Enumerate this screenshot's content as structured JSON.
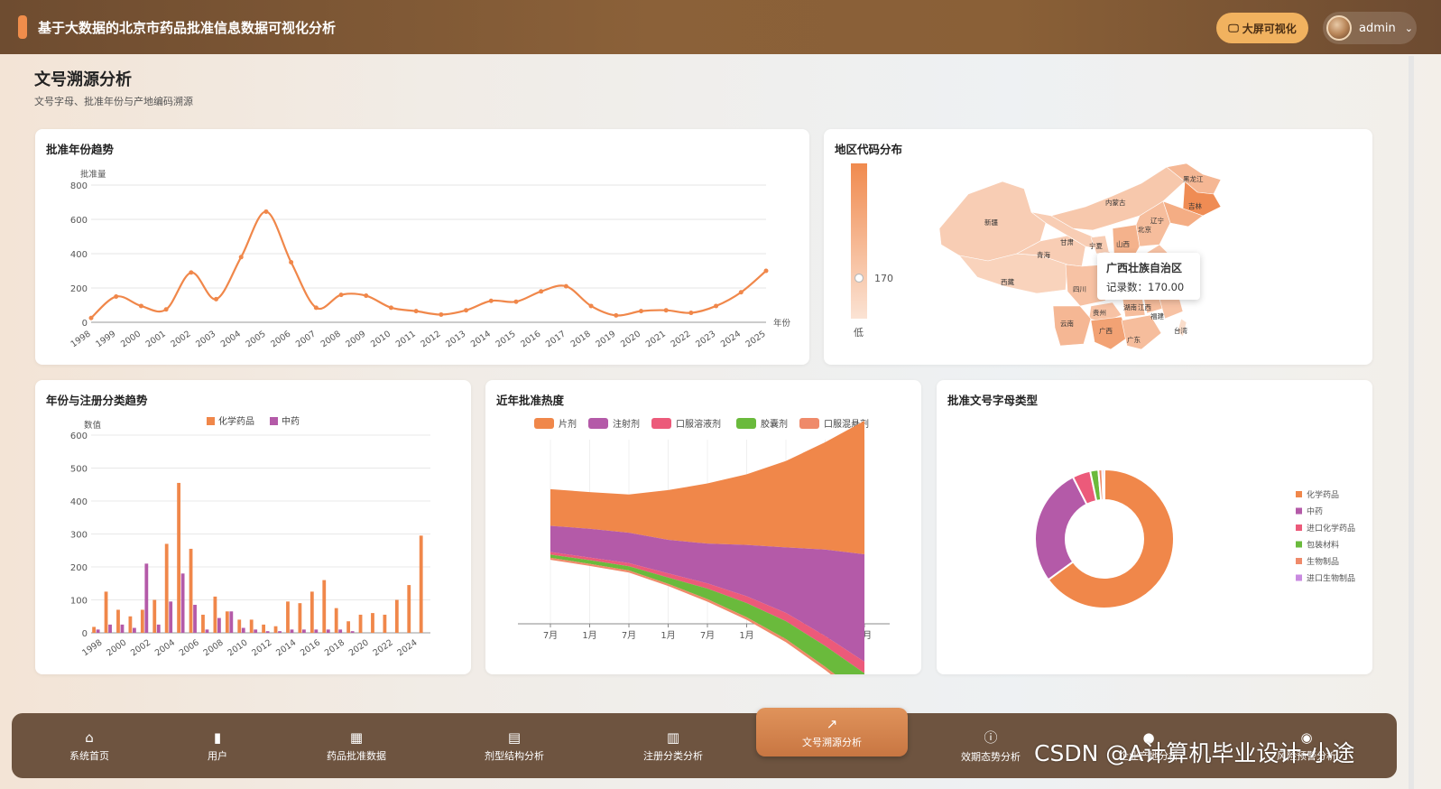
{
  "header": {
    "title": "基于大数据的北京市药品批准信息数据可视化分析",
    "big_screen_label": "大屏可视化",
    "user": "admin"
  },
  "page": {
    "title": "文号溯源分析",
    "subtitle": "文号字母、批准年份与产地编码溯源"
  },
  "cards": {
    "year_trend": "批准年份趋势",
    "region": "地区代码分布",
    "category_trend": "年份与注册分类趋势",
    "heat": "近年批准热度",
    "letter_type": "批准文号字母类型"
  },
  "tooltip": {
    "title": "广西壮族自治区",
    "body": "记录数：170.00"
  },
  "colors": {
    "accent": "#f0874a",
    "purple": "#b45aa8",
    "pink": "#ec5a7a",
    "green": "#6aba3c",
    "salmon": "#ef8a6a",
    "lavender": "#c98ae0"
  },
  "chart_data": [
    {
      "type": "line",
      "title": "批准年份趋势",
      "ylabel": "批准量",
      "xlabel": "年份",
      "ylim": [
        0,
        800
      ],
      "yticks": [
        0,
        200,
        400,
        600,
        800
      ],
      "x": [
        "1998",
        "1999",
        "2000",
        "2001",
        "2002",
        "2003",
        "2004",
        "2005",
        "2006",
        "2007",
        "2008",
        "2009",
        "2010",
        "2011",
        "2012",
        "2013",
        "2014",
        "2015",
        "2016",
        "2017",
        "2018",
        "2019",
        "2020",
        "2021",
        "2022",
        "2023",
        "2024",
        "2025"
      ],
      "values": [
        25,
        150,
        95,
        75,
        290,
        135,
        380,
        645,
        350,
        85,
        160,
        155,
        85,
        65,
        45,
        70,
        125,
        120,
        180,
        210,
        95,
        40,
        65,
        70,
        55,
        95,
        175,
        300
      ],
      "grid": true
    },
    {
      "type": "heatmap",
      "title": "地区代码分布",
      "visual_map": {
        "low_label": "低",
        "current_label": "170",
        "current": 170
      },
      "regions": [
        {
          "name": "新疆",
          "level": 0.2
        },
        {
          "name": "西藏",
          "level": 0.15
        },
        {
          "name": "青海",
          "level": 0.2
        },
        {
          "name": "甘肃",
          "level": 0.2
        },
        {
          "name": "内蒙古",
          "level": 0.25
        },
        {
          "name": "黑龙江",
          "level": 0.4
        },
        {
          "name": "吉林",
          "level": 0.8
        },
        {
          "name": "辽宁",
          "level": 0.5
        },
        {
          "name": "北京",
          "level": 0.5
        },
        {
          "name": "河北",
          "level": 0.35
        },
        {
          "name": "宁夏",
          "level": 0.2
        },
        {
          "name": "山西",
          "level": 0.45
        },
        {
          "name": "四川",
          "level": 0.3
        },
        {
          "name": "贵州",
          "level": 0.3
        },
        {
          "name": "湖南",
          "level": 0.35
        },
        {
          "name": "江西",
          "level": 0.35
        },
        {
          "name": "福建",
          "level": 0.3
        },
        {
          "name": "云南",
          "level": 0.4
        },
        {
          "name": "广西",
          "level": 0.6
        },
        {
          "name": "广东",
          "level": 0.35
        },
        {
          "name": "台湾",
          "level": 0.05
        }
      ]
    },
    {
      "type": "bar",
      "title": "年份与注册分类趋势",
      "ylabel": "数值",
      "ylim": [
        0,
        600
      ],
      "yticks": [
        0,
        100,
        200,
        300,
        400,
        500,
        600
      ],
      "categories": [
        "1998",
        "1999",
        "2000",
        "2001",
        "2002",
        "2003",
        "2004",
        "2005",
        "2006",
        "2007",
        "2008",
        "2009",
        "2010",
        "2011",
        "2012",
        "2013",
        "2014",
        "2015",
        "2016",
        "2017",
        "2018",
        "2019",
        "2020",
        "2021",
        "2022",
        "2023",
        "2024",
        "2025"
      ],
      "xtick_labels": [
        "1998",
        "2000",
        "2002",
        "2004",
        "2006",
        "2008",
        "2010",
        "2012",
        "2014",
        "2016",
        "2018",
        "2020",
        "2022",
        "2024"
      ],
      "series": [
        {
          "name": "化学药品",
          "values": [
            18,
            125,
            70,
            50,
            70,
            100,
            270,
            455,
            255,
            55,
            110,
            65,
            40,
            40,
            25,
            20,
            95,
            90,
            125,
            160,
            75,
            35,
            55,
            60,
            55,
            100,
            145,
            295
          ]
        },
        {
          "name": "中药",
          "values": [
            10,
            25,
            25,
            15,
            210,
            25,
            95,
            180,
            85,
            10,
            45,
            65,
            15,
            10,
            5,
            5,
            10,
            10,
            10,
            10,
            10,
            5,
            0,
            0,
            0,
            0,
            0,
            0
          ]
        }
      ],
      "legend": "top"
    },
    {
      "type": "area",
      "title": "近年批准热度",
      "categories": [
        "7月",
        "1月",
        "7月",
        "1月",
        "7月",
        "1月",
        "7月",
        "1月",
        "7月"
      ],
      "series": [
        {
          "name": "片剂",
          "values": [
            70,
            70,
            73,
            95,
            115,
            135,
            165,
            205,
            255
          ]
        },
        {
          "name": "注射剂",
          "values": [
            50,
            55,
            58,
            64,
            76,
            98,
            125,
            165,
            205
          ]
        },
        {
          "name": "口服溶液剂",
          "values": [
            5,
            5,
            6,
            8,
            10,
            13,
            16,
            19,
            22
          ]
        },
        {
          "name": "胶囊剂",
          "values": [
            6,
            7,
            8,
            12,
            20,
            27,
            34,
            40,
            45
          ]
        },
        {
          "name": "口服混悬剂",
          "values": [
            4,
            4,
            4,
            4,
            5,
            5,
            6,
            6,
            7
          ]
        }
      ],
      "legend": "top"
    },
    {
      "type": "pie",
      "title": "批准文号字母类型",
      "series": [
        {
          "name": "化学药品",
          "value": 65.0
        },
        {
          "name": "中药",
          "value": 27.5
        },
        {
          "name": "进口化学药品",
          "value": 4.2
        },
        {
          "name": "包装材料",
          "value": 1.9
        },
        {
          "name": "生物制品",
          "value": 0.9
        },
        {
          "name": "进口生物制品",
          "value": 0.5
        }
      ],
      "legend": "right"
    }
  ],
  "nav": {
    "items": [
      {
        "label": "系统首页",
        "icon": "home-icon"
      },
      {
        "label": "用户",
        "icon": "bar-chart-icon"
      },
      {
        "label": "药品批准数据",
        "icon": "grid-icon"
      },
      {
        "label": "剂型结构分析",
        "icon": "clipboard-icon"
      },
      {
        "label": "注册分类分析",
        "icon": "calendar-icon"
      },
      {
        "label": "文号溯源分析",
        "icon": "trend-icon"
      },
      {
        "label": "效期态势分析",
        "icon": "alert-icon"
      },
      {
        "label": "企业产地分析",
        "icon": "person-icon"
      },
      {
        "label": "风险预警分析",
        "icon": "bulb-icon"
      }
    ],
    "active_index": 5
  },
  "watermark": "CSDN @A计算机毕业设计-小途"
}
